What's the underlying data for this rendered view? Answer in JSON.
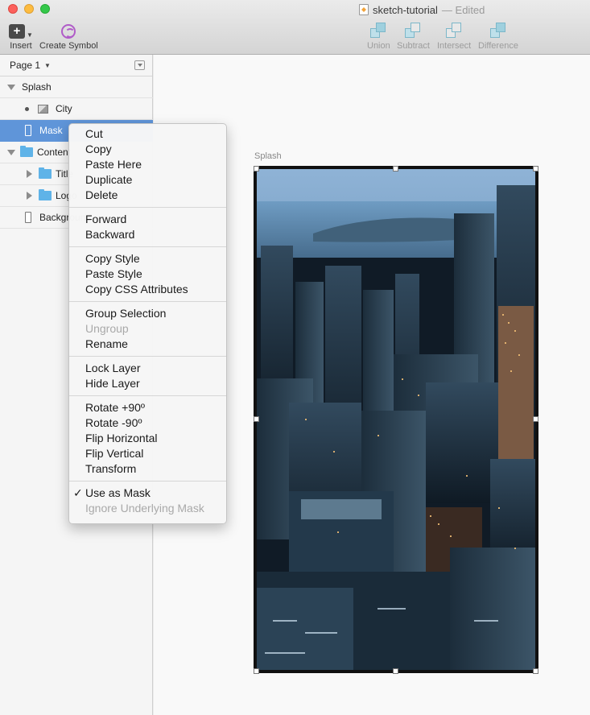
{
  "window": {
    "doc_title": "sketch-tutorial",
    "doc_status": "— Edited"
  },
  "toolbar": {
    "insert_label": "Insert",
    "create_symbol_label": "Create Symbol",
    "union_label": "Union",
    "subtract_label": "Subtract",
    "intersect_label": "Intersect",
    "difference_label": "Difference"
  },
  "sidebar": {
    "page_label": "Page 1",
    "layers": [
      {
        "label": "Splash"
      },
      {
        "label": "City"
      },
      {
        "label": "Mask"
      },
      {
        "label": "Content"
      },
      {
        "label": "Title"
      },
      {
        "label": "Logo"
      },
      {
        "label": "Background"
      }
    ]
  },
  "canvas": {
    "artboard_label": "Splash"
  },
  "context_menu": {
    "groups": [
      [
        "Cut",
        "Copy",
        "Paste Here",
        "Duplicate",
        "Delete"
      ],
      [
        "Forward",
        "Backward"
      ],
      [
        "Copy Style",
        "Paste Style",
        "Copy CSS Attributes"
      ],
      [
        "Group Selection",
        "Ungroup",
        "Rename"
      ],
      [
        "Lock Layer",
        "Hide Layer"
      ],
      [
        "Rotate +90º",
        "Rotate -90º",
        "Flip Horizontal",
        "Flip Vertical",
        "Transform"
      ],
      [
        "Use as Mask",
        "Ignore Underlying Mask"
      ]
    ]
  },
  "colors": {
    "selection": "#5f95d9",
    "folder": "#5fb3e8",
    "symbol_accent": "#b05cc8"
  }
}
